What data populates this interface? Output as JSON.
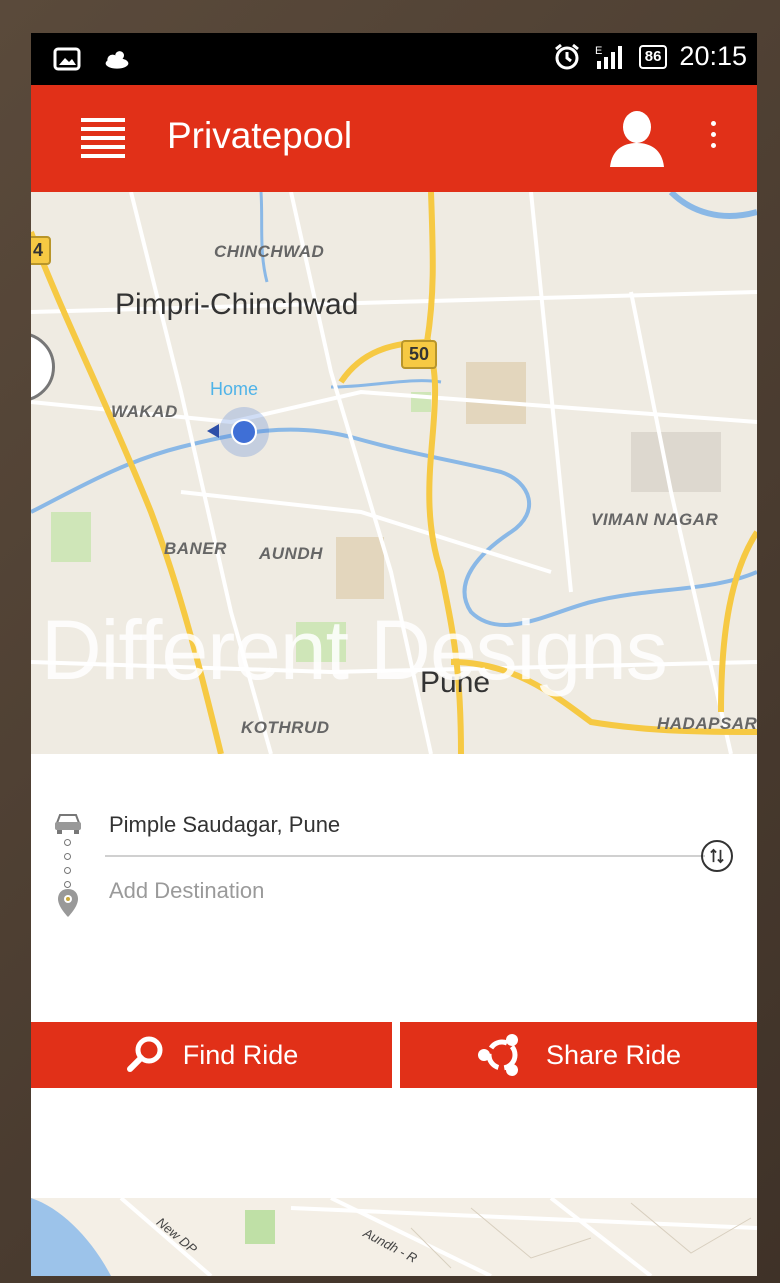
{
  "status_bar": {
    "battery": "86",
    "time": "20:15"
  },
  "app_bar": {
    "title": "Privatepool"
  },
  "map": {
    "labels": {
      "pimpri": "Pimpri-Chinchwad",
      "chinchwad": "CHINCHWAD",
      "wakad": "WAKAD",
      "home": "Home",
      "viman_nagar": "VIMAN NAGAR",
      "baner": "BANER",
      "aundh": "AUNDH",
      "pune": "Pune",
      "kothrud": "KOTHRUD",
      "hadapsar": "HADAPSAR"
    },
    "shields": {
      "nh4": "4",
      "nh50": "50"
    }
  },
  "watermark": "Different Designs",
  "route_form": {
    "origin_value": "Pimple Saudagar, Pune",
    "destination_placeholder": "Add Destination"
  },
  "actions": {
    "find_label": "Find Ride",
    "share_label": "Share Ride"
  },
  "bottom_map": {
    "road_1": "New DP",
    "road_2": "Aundh - R"
  },
  "colors": {
    "accent": "#e13018",
    "map_bg": "#efebe2",
    "road_major": "#f6c943",
    "water": "#7fb4e8"
  }
}
